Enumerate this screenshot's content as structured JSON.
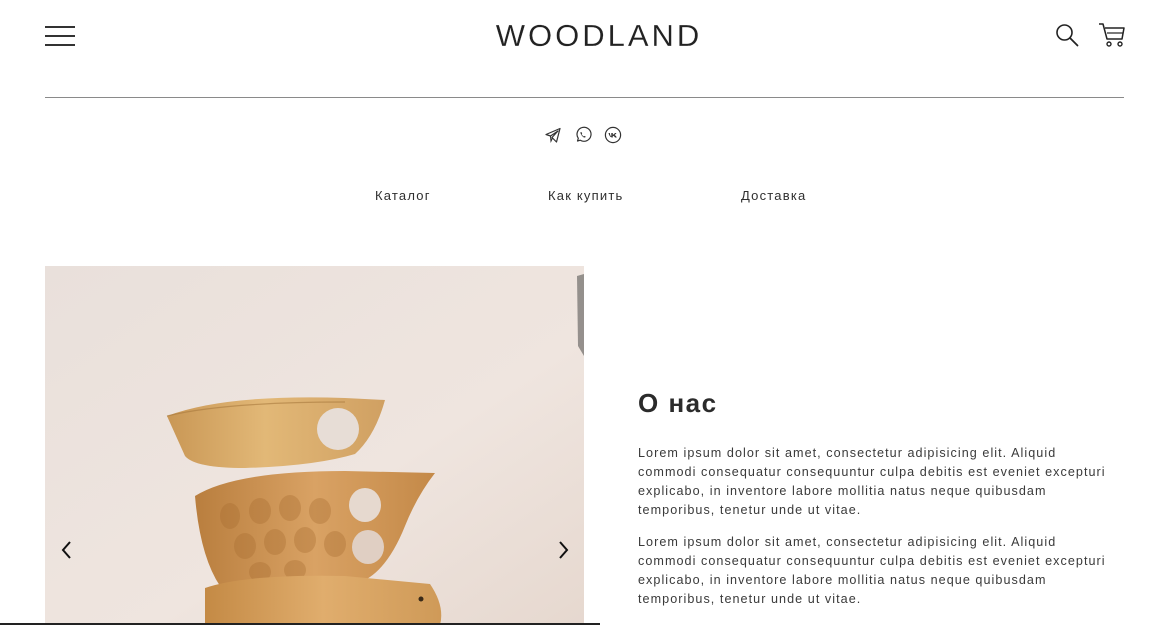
{
  "header": {
    "logo": "WOODLAND"
  },
  "icons": {
    "menu": "hamburger-menu-icon",
    "search": "search-icon",
    "cart": "cart-icon",
    "telegram": "telegram-icon",
    "whatsapp": "whatsapp-icon",
    "vk": "vk-icon",
    "prev": "chevron-left-icon",
    "next": "chevron-right-icon"
  },
  "nav": {
    "items": [
      {
        "label": "Каталог"
      },
      {
        "label": "Как купить"
      },
      {
        "label": "Доставка"
      }
    ]
  },
  "about": {
    "title": "О нас",
    "paragraphs": [
      "Lorem ipsum dolor sit amet, consectetur adipisicing elit. Aliquid commodi consequatur consequuntur culpa debitis est eveniet excepturi explicabo, in inventore labore mollitia natus neque quibusdam temporibus, tenetur unde ut vitae.",
      "Lorem ipsum dolor sit amet, consectetur adipisicing elit. Aliquid commodi consequatur consequuntur culpa debitis est eveniet excepturi explicabo, in inventore labore mollitia natus neque quibusdam temporibus, tenetur unde ut vitae."
    ]
  },
  "colors": {
    "text": "#2b2b2b",
    "divider": "#8a8a8a",
    "slide_background": "#ece2dc",
    "wood": "#d9a868"
  }
}
